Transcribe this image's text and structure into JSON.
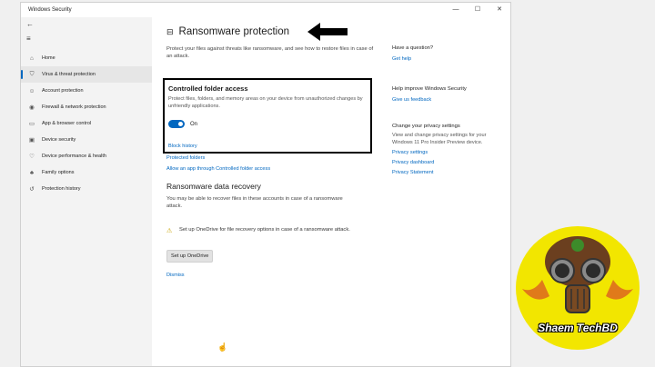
{
  "window": {
    "title": "Windows Security",
    "controls": [
      "—",
      "☐",
      "✕"
    ]
  },
  "sidebar": {
    "items": [
      {
        "label": "Home",
        "icon": "home-icon",
        "glyph": "⌂"
      },
      {
        "label": "Virus & threat protection",
        "icon": "shield-icon",
        "glyph": "⛉"
      },
      {
        "label": "Account protection",
        "icon": "person-icon",
        "glyph": "☺"
      },
      {
        "label": "Firewall & network protection",
        "icon": "wifi-icon",
        "glyph": "◉"
      },
      {
        "label": "App & browser control",
        "icon": "app-window-icon",
        "glyph": "▭"
      },
      {
        "label": "Device security",
        "icon": "device-icon",
        "glyph": "▣"
      },
      {
        "label": "Device performance & health",
        "icon": "heart-icon",
        "glyph": "♡"
      },
      {
        "label": "Family options",
        "icon": "family-icon",
        "glyph": "♣"
      },
      {
        "label": "Protection history",
        "icon": "history-icon",
        "glyph": "↺"
      }
    ]
  },
  "main": {
    "title": "Ransomware protection",
    "description": "Protect your files against threats like ransomware, and see how to restore files in case of an attack.",
    "cfa": {
      "title": "Controlled folder access",
      "description": "Protect files, folders, and memory areas on your device from unauthorized changes by unfriendly applications.",
      "toggle_label": "On",
      "toggle_on": true,
      "block_history": "Block history"
    },
    "protected_folders": "Protected folders",
    "allow_app": "Allow an app through Controlled folder access",
    "recovery": {
      "title": "Ransomware data recovery",
      "description": "You may be able to recover files in these accounts in case of a ransomware attack.",
      "warning": "Set up OneDrive for file recovery options in case of a ransomware attack.",
      "button": "Set up OneDrive",
      "dismiss": "Dismiss"
    }
  },
  "side": {
    "question": {
      "heading": "Have a question?",
      "link": "Get help"
    },
    "improve": {
      "heading": "Help improve Windows Security",
      "link": "Give us feedback"
    },
    "privacy": {
      "heading": "Change your privacy settings",
      "text": "View and change privacy settings for your Windows 11 Pro Insider Preview device.",
      "links": [
        "Privacy settings",
        "Privacy dashboard",
        "Privacy Statement"
      ]
    }
  },
  "watermark": {
    "text": "Shaem TechBD"
  },
  "colors": {
    "accent": "#0067c0",
    "logo_bg": "#f2e600"
  }
}
